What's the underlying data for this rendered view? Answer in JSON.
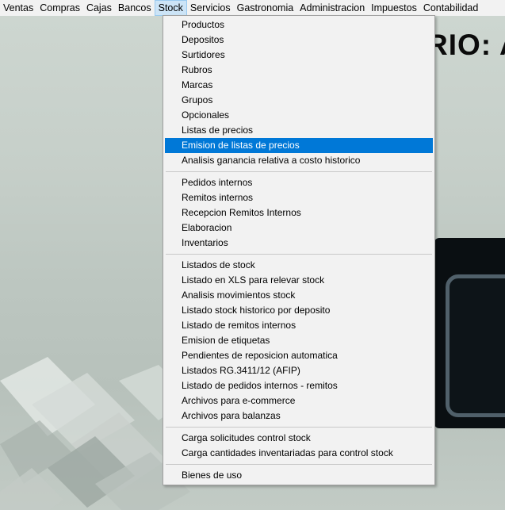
{
  "menubar": {
    "items": [
      "Ventas",
      "Compras",
      "Cajas",
      "Bancos",
      "Stock",
      "Servicios",
      "Gastronomia",
      "Administracion",
      "Impuestos",
      "Contabilidad"
    ],
    "open_index": 4
  },
  "background": {
    "title_fragment": "RIO: A"
  },
  "stock_menu": {
    "group1": [
      "Productos",
      "Depositos",
      "Surtidores",
      "Rubros",
      "Marcas",
      "Grupos",
      "Opcionales",
      "Listas de precios",
      "Emision de listas de precios",
      "Analisis ganancia relativa a costo historico"
    ],
    "group2": [
      "Pedidos internos",
      "Remitos internos",
      "Recepcion Remitos Internos",
      "Elaboracion",
      "Inventarios"
    ],
    "group3": [
      "Listados de stock",
      "Listado en XLS para relevar stock",
      "Analisis movimientos stock",
      "Listado stock historico por  deposito",
      "Listado de remitos internos",
      "Emision de etiquetas",
      "Pendientes de reposicion automatica",
      "Listados RG.3411/12 (AFIP)",
      "Listado de pedidos internos - remitos",
      "Archivos para e-commerce",
      "Archivos para balanzas"
    ],
    "group4": [
      "Carga solicitudes control stock",
      "Carga cantidades inventariadas para control stock"
    ],
    "group5": [
      "Bienes de uso"
    ],
    "highlighted_item": "Emision de listas de precios"
  },
  "colors": {
    "highlight": "#0078d7",
    "menubar_bg": "#f2f2f2",
    "open_menu_bg": "#cce4f7"
  }
}
